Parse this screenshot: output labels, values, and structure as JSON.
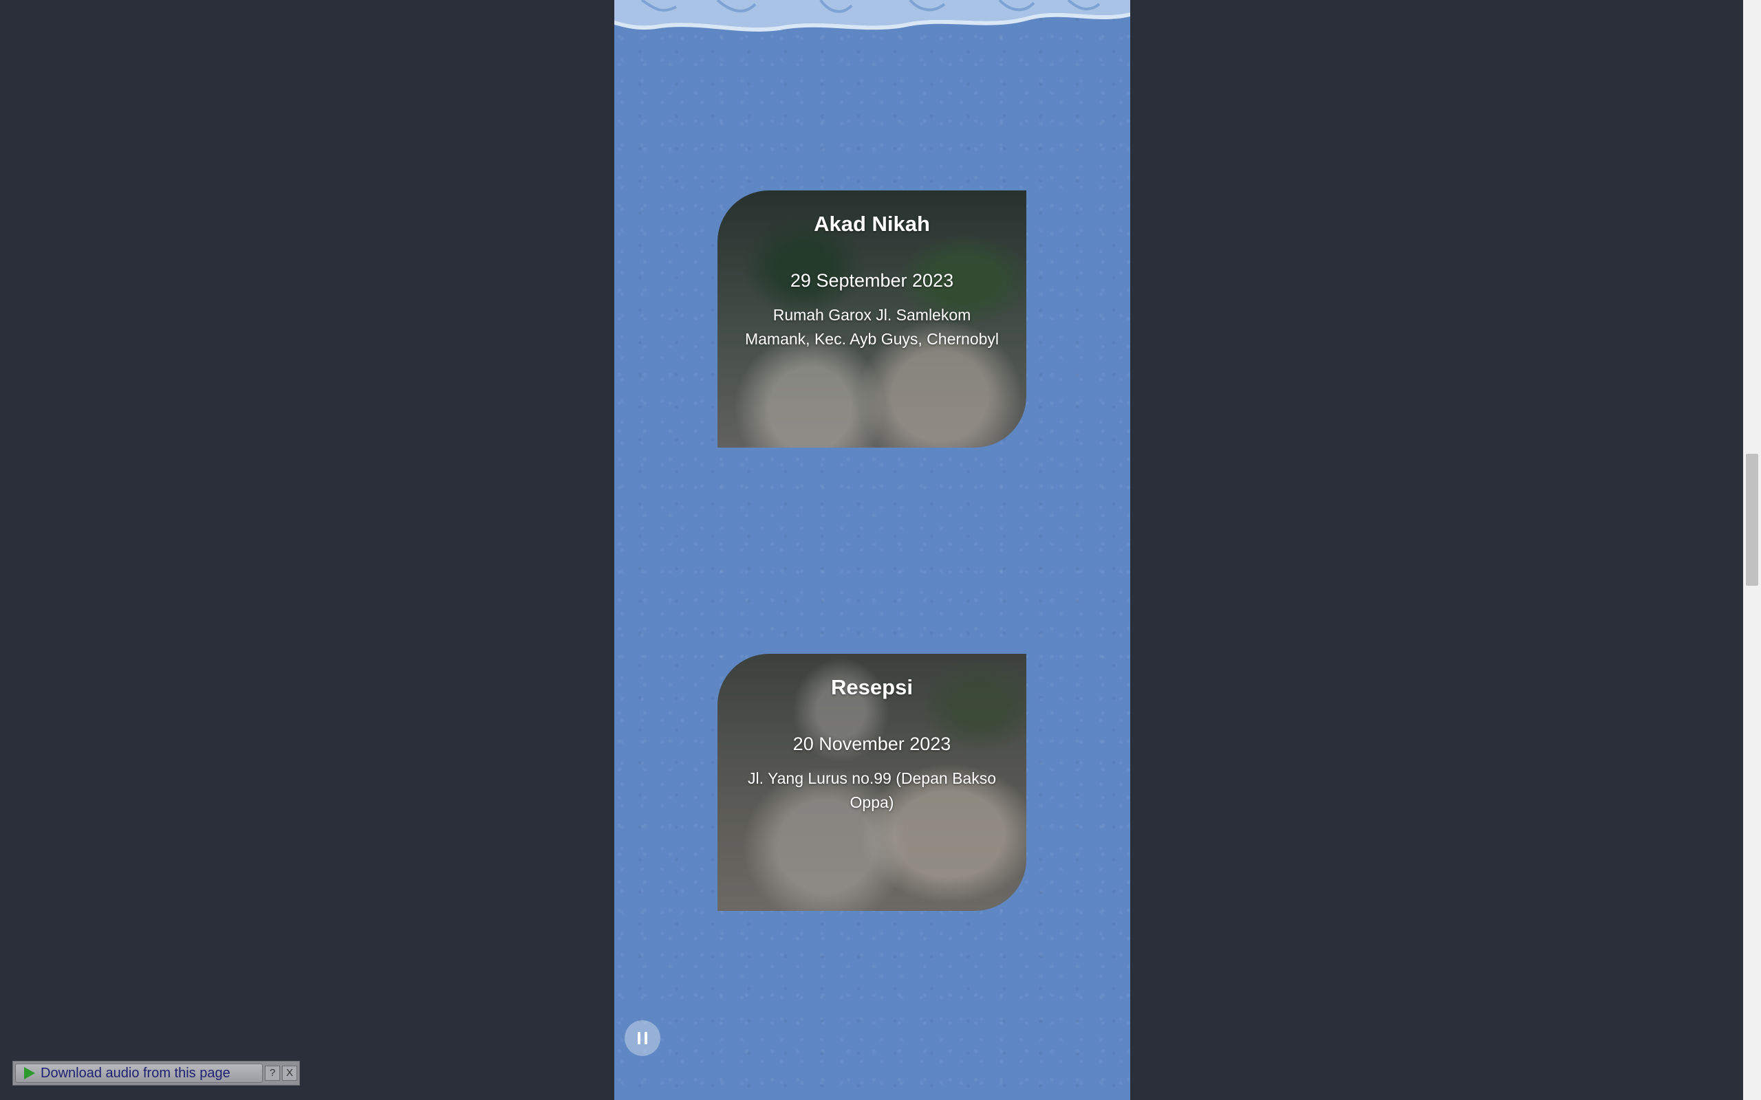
{
  "events": [
    {
      "title": "Akad Nikah",
      "date": "29 September 2023",
      "address": "Rumah Garox Jl. Samlekom Mamank, Kec. Ayb Guys, Chernobyl"
    },
    {
      "title": "Resepsi",
      "date": "20 November 2023",
      "address": "Jl. Yang Lurus no.99 (Depan Bakso Oppa)"
    }
  ],
  "music_player": {
    "state": "playing",
    "icon": "pause-icon"
  },
  "download_bar": {
    "label": "Download audio from this page",
    "help_label": "?",
    "close_label": "X"
  },
  "colors": {
    "page_background": "#2b2f3a",
    "column_background": "#5f87c4",
    "card_text": "#ffffff"
  }
}
